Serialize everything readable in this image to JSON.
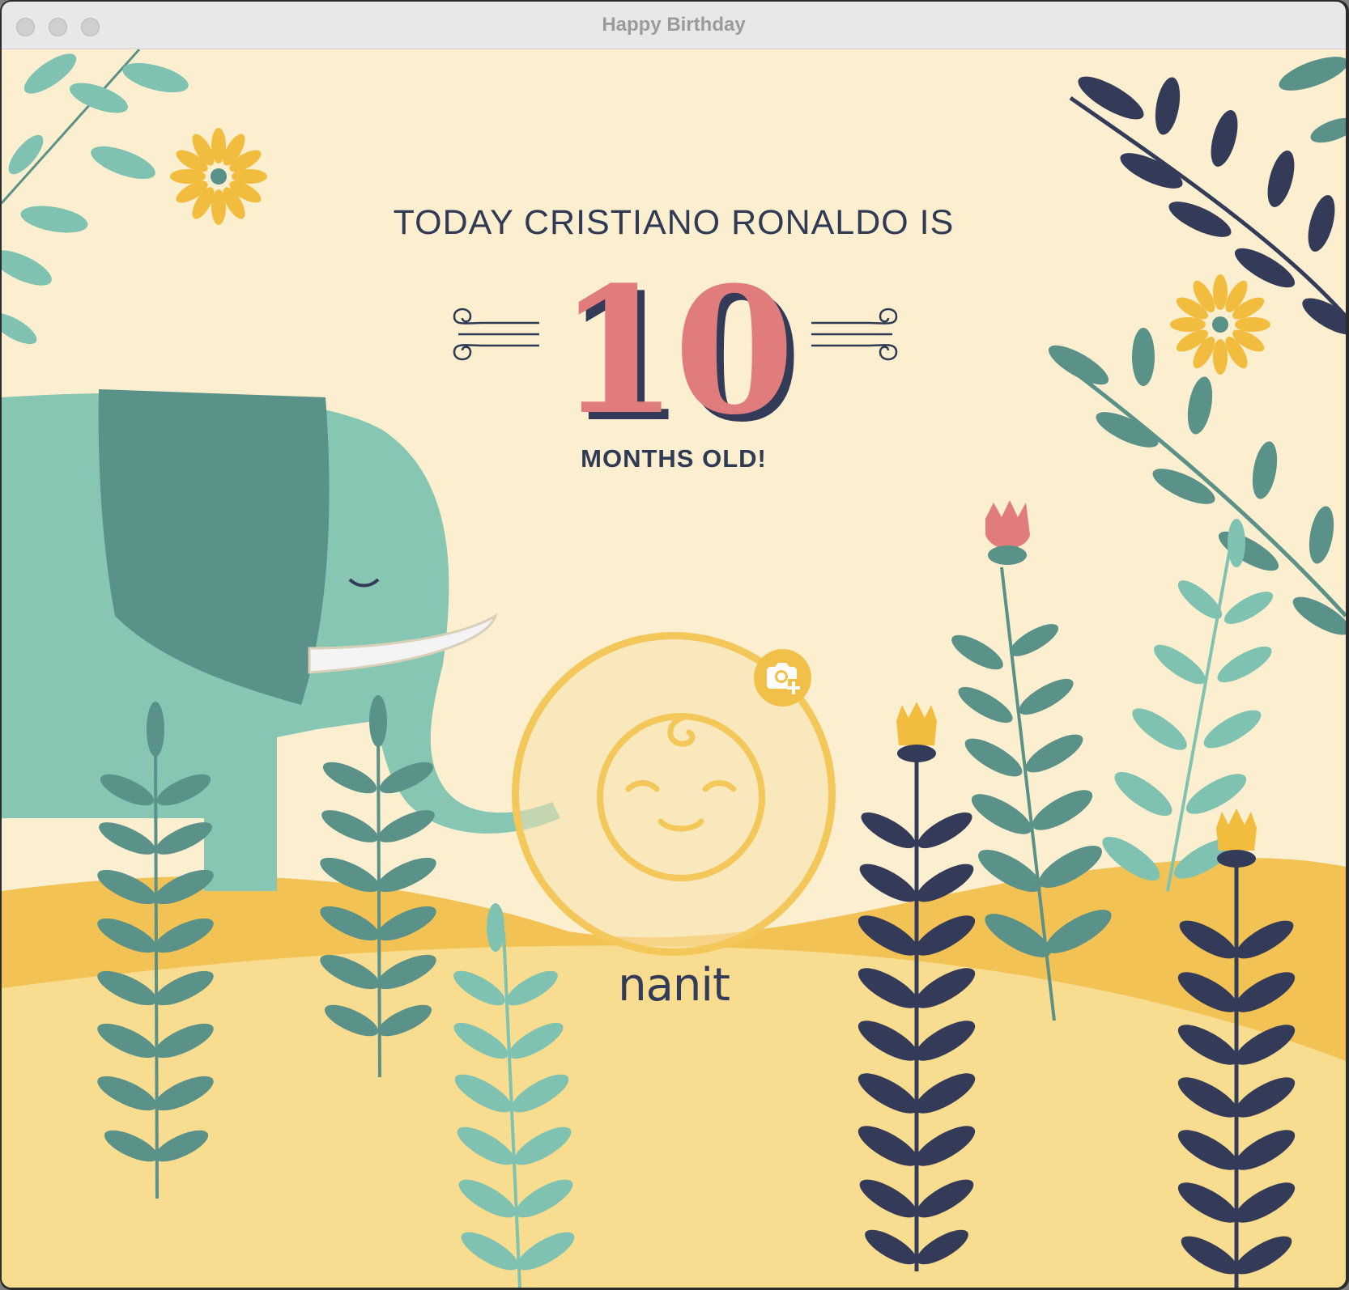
{
  "window": {
    "title": "Happy Birthday"
  },
  "card": {
    "title_line": "TODAY CRISTIANO RONALDO IS",
    "age_number": "10",
    "age_unit_line": "MONTHS OLD!",
    "brand": "nanit"
  },
  "controls": {
    "add_photo_icon": "camera-plus-icon"
  },
  "colors": {
    "background": "#fcefcf",
    "accent_yellow": "#f3c75a",
    "number_pink": "#e07c7c",
    "text_navy": "#2f3a55",
    "teal": "#7fc2b1",
    "dark_teal": "#5a9188"
  }
}
